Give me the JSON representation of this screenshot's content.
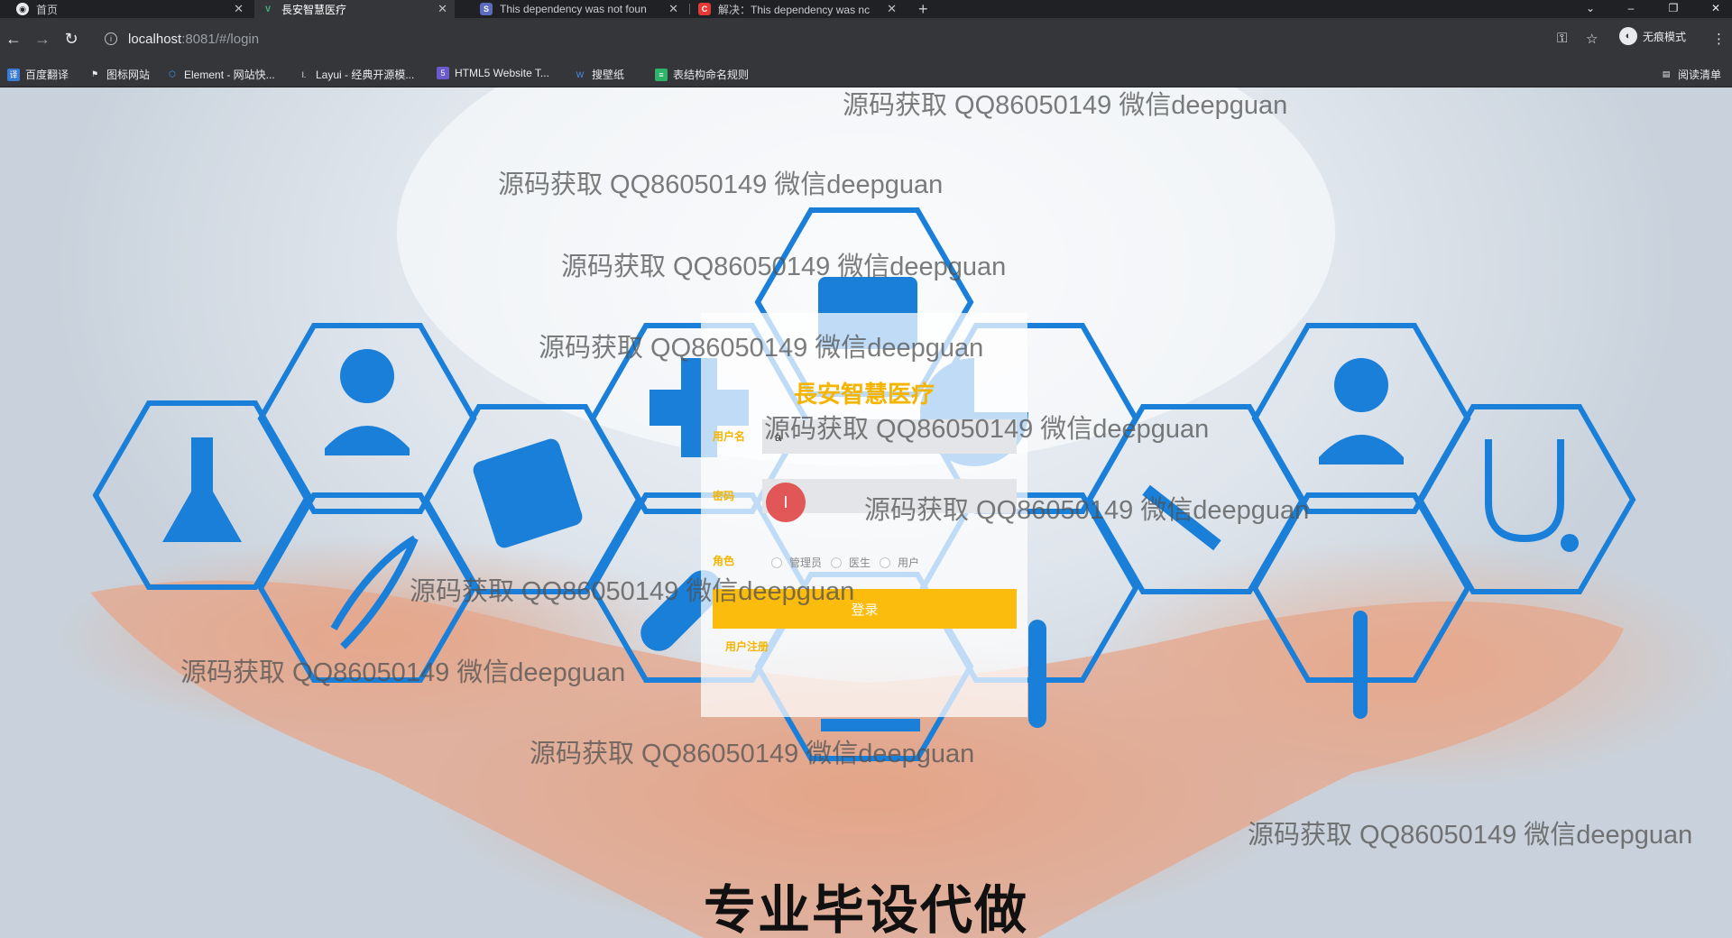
{
  "browser": {
    "tabs": [
      {
        "title": "首页",
        "active": false
      },
      {
        "title": "長安智慧医疗",
        "active": true
      },
      {
        "title": "This dependency was not foun",
        "active": false
      },
      {
        "title": "解决：This dependency was nc",
        "active": false
      }
    ],
    "url_host": "localhost",
    "url_rest": ":8081/#/login",
    "incognito_label": "无痕模式",
    "bookmarks": [
      {
        "label": "百度翻译",
        "icon": "translate-icon",
        "color": "#3a7bd5"
      },
      {
        "label": "图标网站",
        "icon": "flag-icon",
        "color": "#e8eaed"
      },
      {
        "label": "Element - 网站快...",
        "icon": "element-icon",
        "color": "#409eff"
      },
      {
        "label": "Layui - 经典开源模...",
        "icon": "layui-icon",
        "color": "#e8eaed"
      },
      {
        "label": "HTML5 Website T...",
        "icon": "html5-icon",
        "color": "#6a5acd"
      },
      {
        "label": "搜壁纸",
        "icon": "wallpaper-icon",
        "color": "#4a8ff0"
      },
      {
        "label": "表结构命名规则",
        "icon": "doc-icon",
        "color": "#2fb36b"
      }
    ],
    "reading_list": "阅读清单"
  },
  "login": {
    "title": "長安智慧医疗",
    "username_label": "用户名",
    "username_value": "a",
    "password_label": "密码",
    "password_value": "",
    "role_label": "角色",
    "roles": [
      "管理员",
      "医生",
      "用户"
    ],
    "login_button": "登录",
    "register_link": "用户注册"
  },
  "watermark_text": "源码获取 QQ86050149 微信deepguan",
  "subtitle": "专业毕设代做",
  "colors": {
    "accent": "#fcbc0e",
    "hex_blue": "#1a7fd9"
  }
}
